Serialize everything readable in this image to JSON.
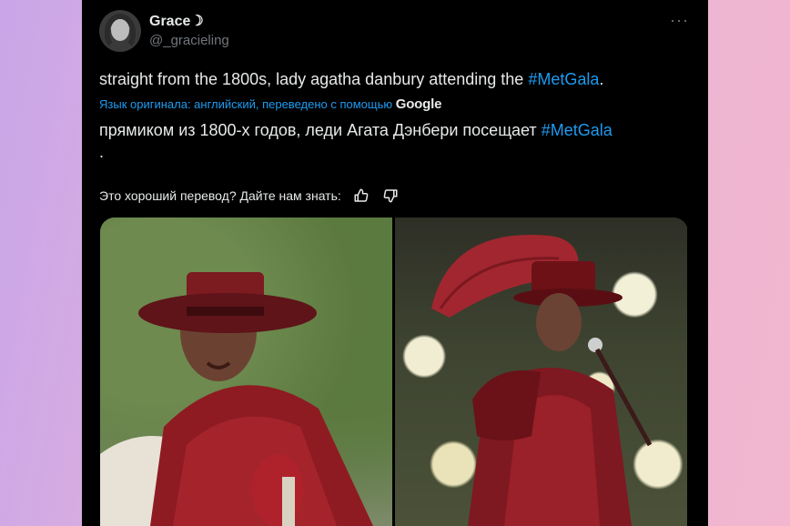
{
  "tweet": {
    "author_name": "Grace☽",
    "author_handle": "@_gracieling",
    "more_label": "···",
    "text_before": "straight from the 1800s, lady agatha danbury attending the ",
    "hashtag": "#MetGala",
    "text_after": ".",
    "translated_by_prefix": "Язык оригинала: английский, переведено с помощью",
    "translated_by_provider": "Google",
    "translation_before": "прямиком из 1800-х годов, леди Агата Дэнбери посещает ",
    "translation_hashtag": "#MetGala",
    "translation_after": ".",
    "feedback_prompt": "Это хороший перевод? Дайте нам знать:"
  },
  "media": [
    {
      "name": "photo-left-lady-danbury"
    },
    {
      "name": "photo-right-met-gala"
    }
  ],
  "colors": {
    "background_left": "#c9a6e8",
    "background_right": "#f2b7cf",
    "card": "#000000",
    "text": "#e7e9ea",
    "muted": "#71767b",
    "link": "#1d9bf0"
  }
}
